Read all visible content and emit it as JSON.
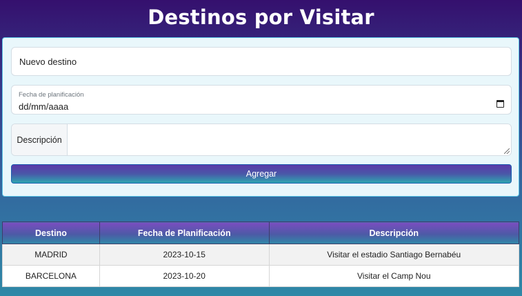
{
  "header": {
    "title": "Destinos por Visitar"
  },
  "form": {
    "destino_placeholder": "Nuevo destino",
    "fecha_label": "Fecha de planificación",
    "fecha_value": "dd/mm/aaaa",
    "descripcion_label": "Descripción",
    "add_button_label": "Agregar"
  },
  "table": {
    "headers": [
      "Destino",
      "Fecha de Planificación",
      "Descripción"
    ],
    "rows": [
      [
        "MADRID",
        "2023-10-15",
        "Visitar el estadio Santiago Bernabéu"
      ],
      [
        "BARCELONA",
        "2023-10-20",
        "Visitar el Camp Nou"
      ]
    ]
  },
  "colors": {
    "accent_purple": "#35106e",
    "accent_teal": "#2f88a7",
    "form_bg": "#e9f7fb"
  }
}
